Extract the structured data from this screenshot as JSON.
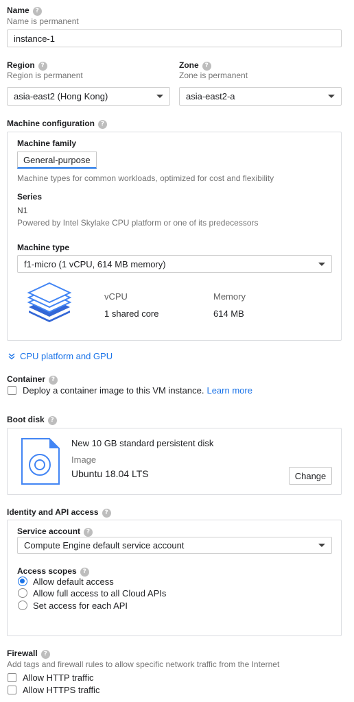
{
  "name": {
    "label": "Name",
    "sublabel": "Name is permanent",
    "value": "instance-1"
  },
  "region": {
    "label": "Region",
    "sublabel": "Region is permanent",
    "value": "asia-east2 (Hong Kong)"
  },
  "zone": {
    "label": "Zone",
    "sublabel": "Zone is permanent",
    "value": "asia-east2-a"
  },
  "machine_config": {
    "label": "Machine configuration",
    "family_label": "Machine family",
    "family_tab": "General-purpose",
    "family_desc": "Machine types for common workloads, optimized for cost and flexibility",
    "series_label": "Series",
    "series_value": "N1",
    "series_desc": "Powered by Intel Skylake CPU platform or one of its predecessors",
    "type_label": "Machine type",
    "type_value": "f1-micro (1 vCPU, 614 MB memory)",
    "vcpu_header": "vCPU",
    "vcpu_value": "1 shared core",
    "memory_header": "Memory",
    "memory_value": "614 MB",
    "icon": "stacked-layers-icon"
  },
  "cpu_platform": {
    "label": "CPU platform and GPU",
    "icon": "double-chevron-down-icon"
  },
  "container": {
    "label": "Container",
    "checkbox_text": "Deploy a container image to this VM instance.",
    "learn_more": "Learn more",
    "checked": false
  },
  "boot_disk": {
    "label": "Boot disk",
    "title": "New 10 GB standard persistent disk",
    "image_label": "Image",
    "image_value": "Ubuntu 18.04 LTS",
    "change_button": "Change",
    "icon": "disk-file-icon"
  },
  "identity": {
    "label": "Identity and API access",
    "service_account_label": "Service account",
    "service_account_value": "Compute Engine default service account",
    "access_scopes_label": "Access scopes",
    "scopes": [
      {
        "label": "Allow default access",
        "selected": true
      },
      {
        "label": "Allow full access to all Cloud APIs",
        "selected": false
      },
      {
        "label": "Set access for each API",
        "selected": false
      }
    ]
  },
  "firewall": {
    "label": "Firewall",
    "sublabel": "Add tags and firewall rules to allow specific network traffic from the Internet",
    "options": [
      {
        "label": "Allow HTTP traffic",
        "checked": false
      },
      {
        "label": "Allow HTTPS traffic",
        "checked": false
      }
    ]
  },
  "colors": {
    "accent": "#1a73e8",
    "border": "#dadce0",
    "muted": "#757575",
    "help_icon": "#bdbdbd"
  }
}
